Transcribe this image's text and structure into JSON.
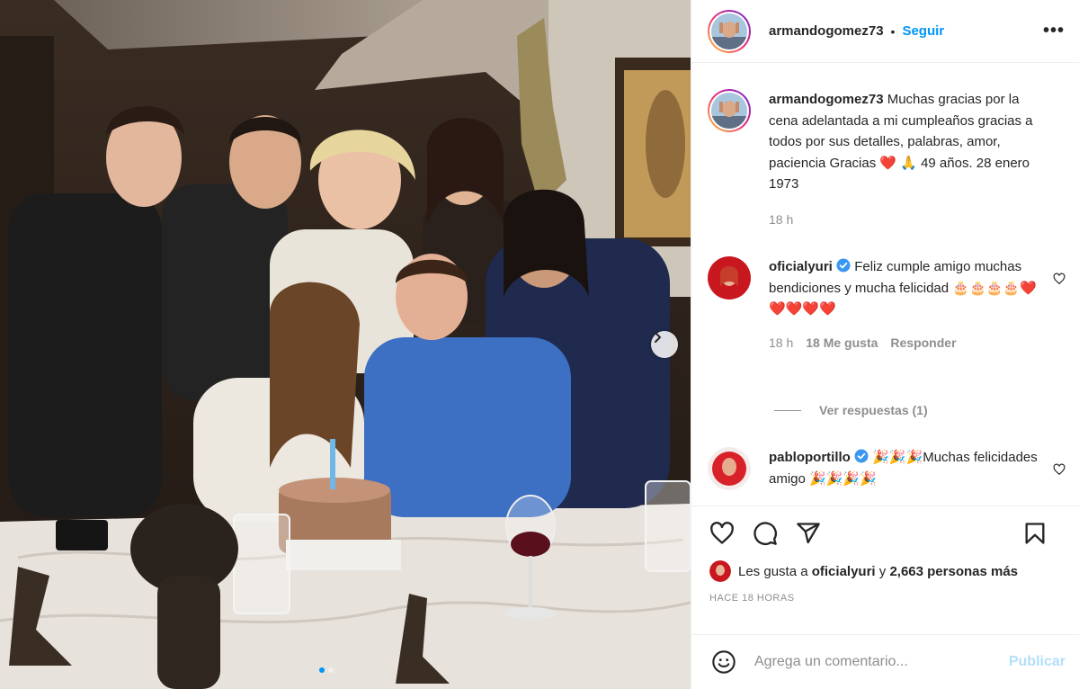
{
  "post": {
    "author": "armandogomez73",
    "separator": "•",
    "follow_label": "Seguir",
    "more_label": "•••",
    "caption_user": "armandogomez73",
    "caption_text": "Muchas gracias por la cena adelantada a mi cumpleaños gracias a todos por sus detalles, palabras, amor, paciencia Gracias ❤️ 🙏 49 años. 28 enero 1973",
    "caption_time": "18 h"
  },
  "comments": [
    {
      "user": "oficialyuri",
      "verified": true,
      "text": "Feliz cumple amigo muchas bendiciones y mucha felicidad 🎂🎂🎂🎂❤️❤️❤️❤️❤️",
      "time": "18 h",
      "likes": "18 Me gusta",
      "reply_label": "Responder",
      "view_replies": "Ver respuestas (1)"
    },
    {
      "user": "pablopportillo",
      "display_user": "pabloportillo",
      "verified": true,
      "text": "🎉🎉🎉Muchas felicidades amigo 🎉🎉🎉🎉"
    }
  ],
  "likes": {
    "prefix": "Les gusta a",
    "user": "oficialyuri",
    "middle": "y",
    "count": "2,663 personas más"
  },
  "timestamp": "HACE 18 HORAS",
  "add_comment": {
    "placeholder": "Agrega un comentario...",
    "publish_label": "Publicar"
  },
  "carousel": {
    "total": 2,
    "active_index": 0
  },
  "icons": [
    "heart-icon",
    "comment-icon",
    "share-icon",
    "bookmark-icon",
    "emoji-icon",
    "chevron-right-icon",
    "verified-badge-icon",
    "more-icon"
  ],
  "colors": {
    "link_blue": "#0095f6",
    "publish_disabled": "#b2dffc",
    "muted": "#8e8e8e",
    "text": "#262626"
  }
}
